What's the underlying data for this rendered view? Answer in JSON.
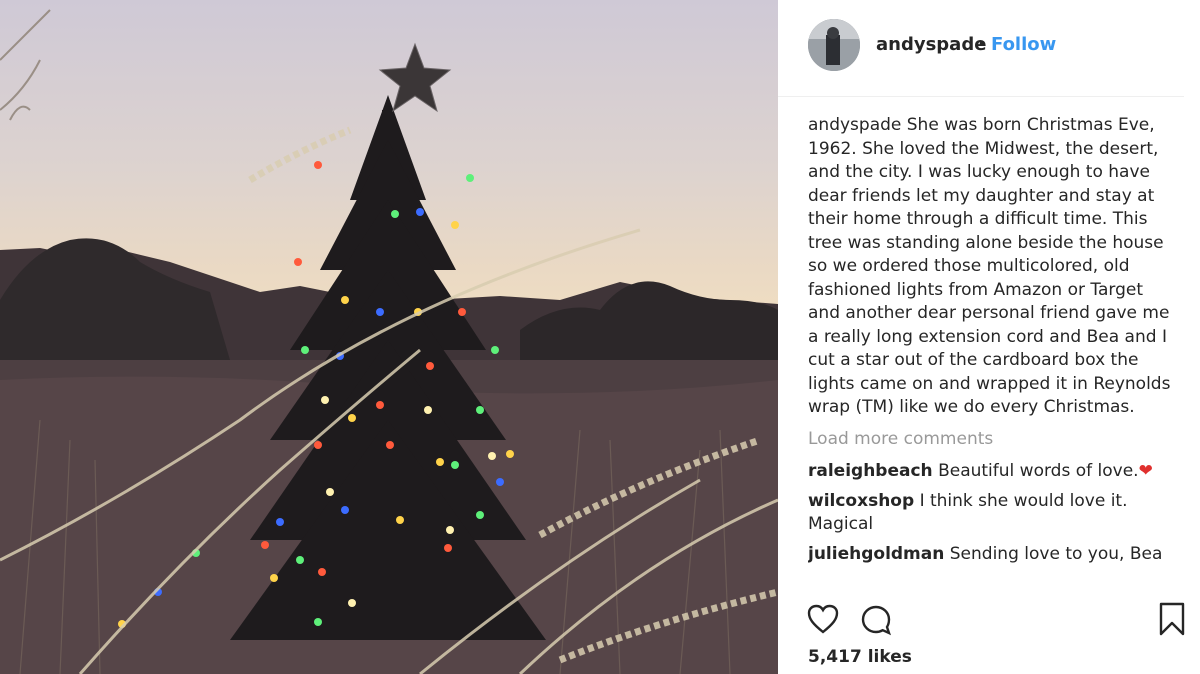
{
  "post": {
    "image": {
      "description_icon": "christmas-tree-photo"
    },
    "header": {
      "username": "andyspade",
      "separator": "•",
      "follow_label": "Follow"
    },
    "caption": {
      "username": "andyspade",
      "text": "She was born Christmas Eve, 1962. She loved the Midwest, the desert, and the city. I was lucky enough to have dear friends let my daughter and stay at their home through a difficult time. This tree was standing alone beside the house so we ordered those multicolored, old fashioned lights from Amazon or Target and another dear personal friend gave me a really long extension cord and Bea and I cut a star out of the cardboard box the lights came on and wrapped it in Reynolds wrap (TM) like we do every Christmas."
    },
    "load_more_label": "Load more comments",
    "comments": [
      {
        "username": "raleighbeach",
        "text": "Beautiful words of love.",
        "emoji": "❤"
      },
      {
        "username": "wilcoxshop",
        "text": "I think she would love it. Magical"
      },
      {
        "username": "juliehgoldman",
        "text": "Sending love to you, Bea"
      }
    ],
    "likes": "5,417 likes",
    "colors": {
      "accent": "#3897f0",
      "text": "#262626",
      "muted": "#999999",
      "heart": "#e0302e"
    }
  }
}
